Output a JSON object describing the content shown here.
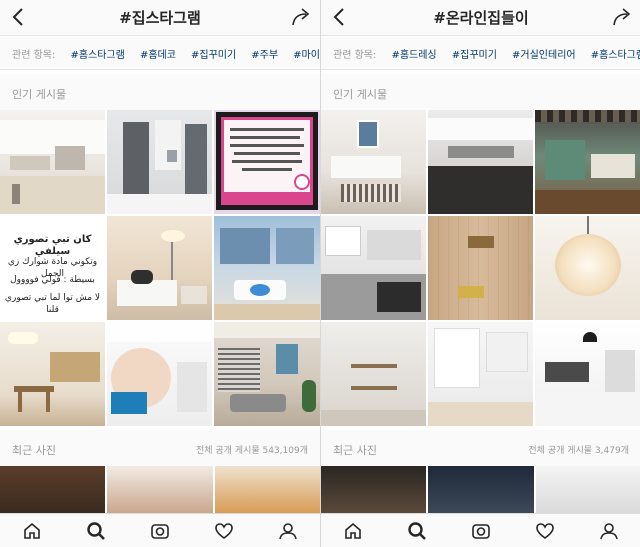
{
  "left": {
    "title": "#집스타그램",
    "related_label": "관련 항목:",
    "related_tags": [
      "#홈스타그램",
      "#홈데코",
      "#집꾸미기",
      "#주부",
      "#마이홈"
    ],
    "top_posts_title": "인기 게시물",
    "recent_title": "최근 사진",
    "recent_count": "전체 공개 게시물 543,109개",
    "arabic_post": {
      "lines": [
        "كان تبي تصوري سيلفي",
        "وتكوني مادة شوارك زي الجمل",
        "بسيطة : قولي فوووول",
        "لا مش توا لما تبي تصوري قلنا"
      ]
    }
  },
  "right": {
    "title": "#온라인집들이",
    "related_label": "관련 항목:",
    "related_tags": [
      "#홈드레싱",
      "#집꾸미기",
      "#거실인테리어",
      "#홈스타그램"
    ],
    "top_posts_title": "인기 게시물",
    "recent_title": "최근 사진",
    "recent_count": "전체 공개 게시물 3,479개"
  },
  "icons": {
    "back": "chevron-left-icon",
    "share": "share-arrow-icon",
    "tabs": [
      "home-icon",
      "search-icon",
      "camera-icon",
      "heart-icon",
      "profile-icon"
    ]
  },
  "colors": {
    "tag": "#003569",
    "muted": "#999999",
    "bar": "#fafafa"
  }
}
